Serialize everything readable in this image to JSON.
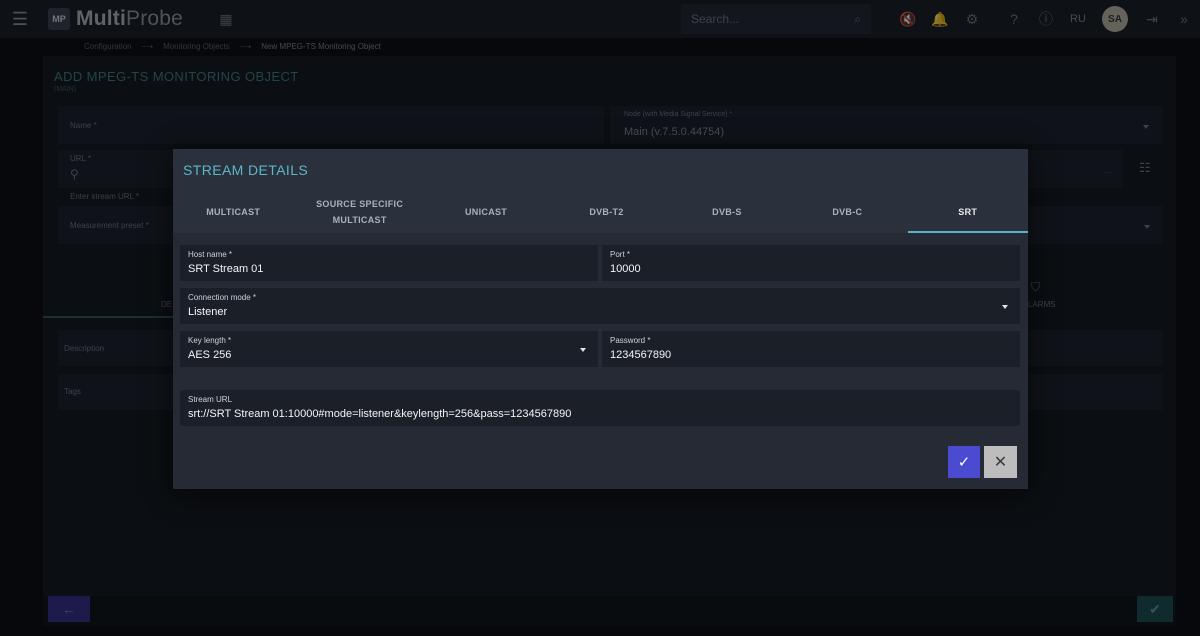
{
  "app": {
    "name_prefix": "Multi",
    "name_suffix": "Probe",
    "logo_badge": "MP",
    "search_placeholder": "Search...",
    "lang": "RU",
    "avatar_initials": "SA"
  },
  "breadcrumb": [
    "Configuration",
    "Monitoring Objects",
    "New MPEG-TS Monitoring Object"
  ],
  "page": {
    "title": "ADD MPEG-TS MONITORING OBJECT",
    "subtitle": "(MAIN)",
    "fields": {
      "name_label": "Name *",
      "node_label": "Node (with Media Signal Service) *",
      "node_value": "Main (v.7.5.0.44754)",
      "url_label": "URL *",
      "url_hint": "Enter stream URL *",
      "preset_label": "Measurement preset *",
      "description_label": "Description",
      "tags_label": "Tags",
      "partial_tab_left": "DE",
      "partial_tab_right": "LARMS"
    }
  },
  "dialog": {
    "title": "STREAM DETAILS",
    "tabs": [
      "MULTICAST",
      "SOURCE SPECIFIC MULTICAST",
      "UNICAST",
      "DVB-T2",
      "DVB-S",
      "DVB-C",
      "SRT"
    ],
    "active_tab": "SRT",
    "fields": {
      "host_name": {
        "label": "Host name *",
        "value": "SRT Stream 01"
      },
      "port": {
        "label": "Port *",
        "value": "10000"
      },
      "connection_mode": {
        "label": "Connection mode *",
        "value": "Listener"
      },
      "key_length": {
        "label": "Key length *",
        "value": "AES 256"
      },
      "password": {
        "label": "Password *",
        "value": "1234567890"
      },
      "stream_url": {
        "label": "Stream URL",
        "value": "srt://SRT Stream 01:10000#mode=listener&keylength=256&pass=1234567890"
      }
    },
    "buttons": {
      "ok_icon": "check-icon",
      "cancel_icon": "close-icon"
    }
  },
  "colors": {
    "accent": "#5db7c6",
    "primary_button": "#4a4bd1",
    "dialog_bg": "#2a303c",
    "field_bg": "#1b1f28"
  }
}
